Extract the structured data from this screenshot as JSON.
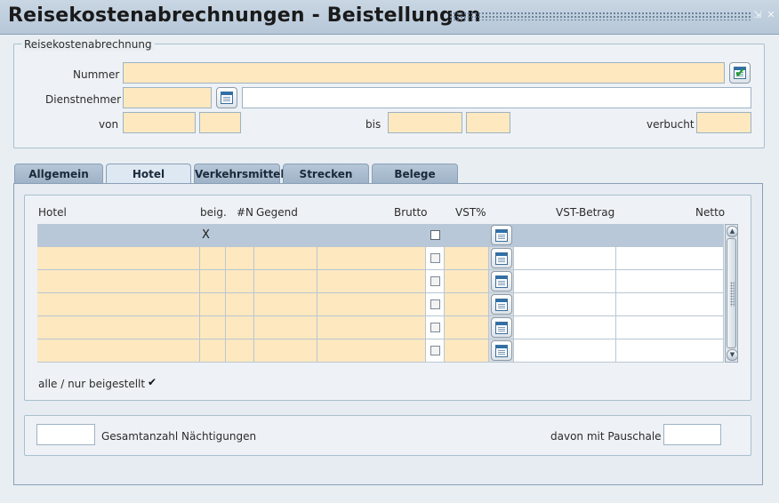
{
  "window": {
    "title": "Reisekostenabrechnungen - Beistellungen",
    "buttons": {
      "minimize": "⇲",
      "close": "✕"
    }
  },
  "header_group": {
    "title": "Reisekostenabrechnung",
    "nummer": {
      "label": "Nummer",
      "value": ""
    },
    "dienstnehmer": {
      "label": "Dienstnehmer",
      "code": "",
      "name": ""
    },
    "von": {
      "label": "von",
      "date": "",
      "time": ""
    },
    "bis": {
      "label": "bis",
      "date": "",
      "time": ""
    },
    "verbucht": {
      "label": "verbucht",
      "value": ""
    }
  },
  "tabs": [
    {
      "label": "Allgemein",
      "active": false
    },
    {
      "label": "Hotel",
      "active": true
    },
    {
      "label": "Verkehrsmittel",
      "active": false
    },
    {
      "label": "Strecken",
      "active": false
    },
    {
      "label": "Belege",
      "active": false
    }
  ],
  "table": {
    "columns": {
      "hotel": "Hotel",
      "beig": "beig.",
      "n": "#N",
      "gegend": "Gegend",
      "brutto": "Brutto",
      "vst_pct": "VST%",
      "vst_betrag": "VST-Betrag",
      "netto": "Netto"
    },
    "rows": [
      {
        "hotel": "",
        "beig": "X",
        "n": "",
        "gegend": "",
        "brutto": "",
        "vst_pct": "",
        "vst_betrag": "",
        "netto": ""
      },
      {
        "hotel": "",
        "beig": "",
        "n": "",
        "gegend": "",
        "brutto": "",
        "vst_pct": "",
        "vst_betrag": "",
        "netto": ""
      },
      {
        "hotel": "",
        "beig": "",
        "n": "",
        "gegend": "",
        "brutto": "",
        "vst_pct": "",
        "vst_betrag": "",
        "netto": ""
      },
      {
        "hotel": "",
        "beig": "",
        "n": "",
        "gegend": "",
        "brutto": "",
        "vst_pct": "",
        "vst_betrag": "",
        "netto": ""
      },
      {
        "hotel": "",
        "beig": "",
        "n": "",
        "gegend": "",
        "brutto": "",
        "vst_pct": "",
        "vst_betrag": "",
        "netto": ""
      },
      {
        "hotel": "",
        "beig": "",
        "n": "",
        "gegend": "",
        "brutto": "",
        "vst_pct": "",
        "vst_betrag": "",
        "netto": ""
      }
    ]
  },
  "filter": {
    "label": "alle / nur beigestellt",
    "checked_glyph": "✔"
  },
  "summary": {
    "gesamt_label": "Gesamtanzahl Nächtigungen",
    "gesamt_value": "",
    "pauschale_label": "davon mit Pauschale",
    "pauschale_value": ""
  },
  "colors": {
    "field": "#fde8c0",
    "header_row": "#b8c8d8",
    "accent": "#2f6fa8"
  }
}
